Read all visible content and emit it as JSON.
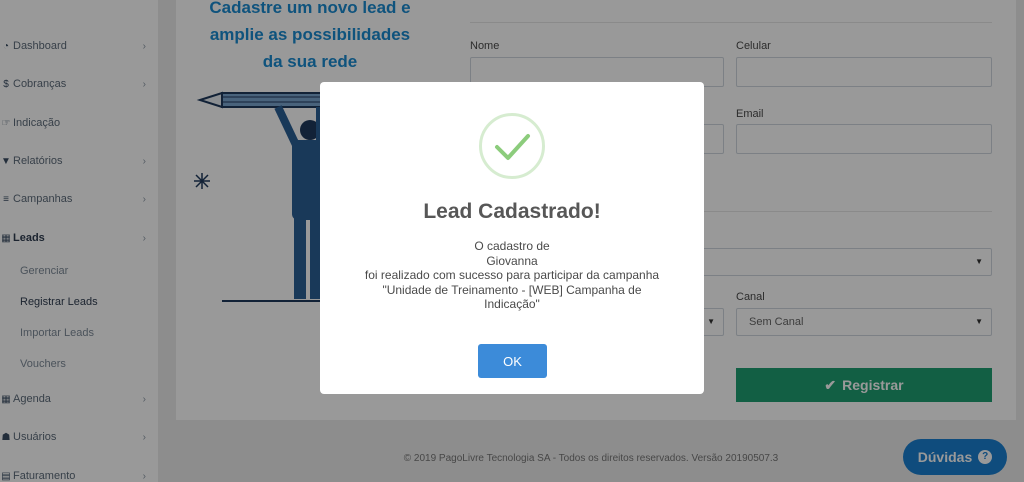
{
  "sidebar": {
    "items": [
      {
        "icon": "dashboard-icon",
        "label": "Dashboard"
      },
      {
        "icon": "dollar-icon",
        "label": "Cobranças"
      },
      {
        "icon": "hand-pointer-icon",
        "label": "Indicação"
      },
      {
        "icon": "filter-icon",
        "label": "Relatórios"
      },
      {
        "icon": "list-icon",
        "label": "Campanhas"
      },
      {
        "icon": "calendar-icon",
        "label": "Leads"
      },
      {
        "icon": "calendar-icon",
        "label": "Agenda"
      },
      {
        "icon": "users-icon",
        "label": "Usuários"
      },
      {
        "icon": "invoice-icon",
        "label": "Faturamento"
      }
    ],
    "leads_submenu": [
      "Gerenciar",
      "Registrar Leads",
      "Importar Leads",
      "Vouchers"
    ]
  },
  "promo": {
    "line1": "Cadastre um novo lead e",
    "line2": "amplie as possibilidades",
    "line3": "da sua rede"
  },
  "form": {
    "nome_label": "Nome",
    "celular_label": "Celular",
    "email_label": "Email",
    "canal_label": "Canal",
    "canal_value": "Sem Canal",
    "register_label": "Registrar"
  },
  "footer": {
    "text": "© 2019 PagoLivre Tecnologia SA - Todos os direitos reservados. Versão 20190507.3"
  },
  "help_button": {
    "label": "Dúvidas"
  },
  "modal": {
    "title": "Lead Cadastrado!",
    "line1": "O cadastro de",
    "line2": "Giovanna",
    "line3": "foi realizado com sucesso para participar da campanha",
    "line4": "\"Unidade de Treinamento - [WEB] Campanha de",
    "line5": "Indicação\"",
    "ok_label": "OK"
  },
  "colors": {
    "accent_blue": "#1a8bd1",
    "register_green": "#1e9f72",
    "ok_blue": "#3c8bd9",
    "success_check": "#8ccc7c"
  }
}
